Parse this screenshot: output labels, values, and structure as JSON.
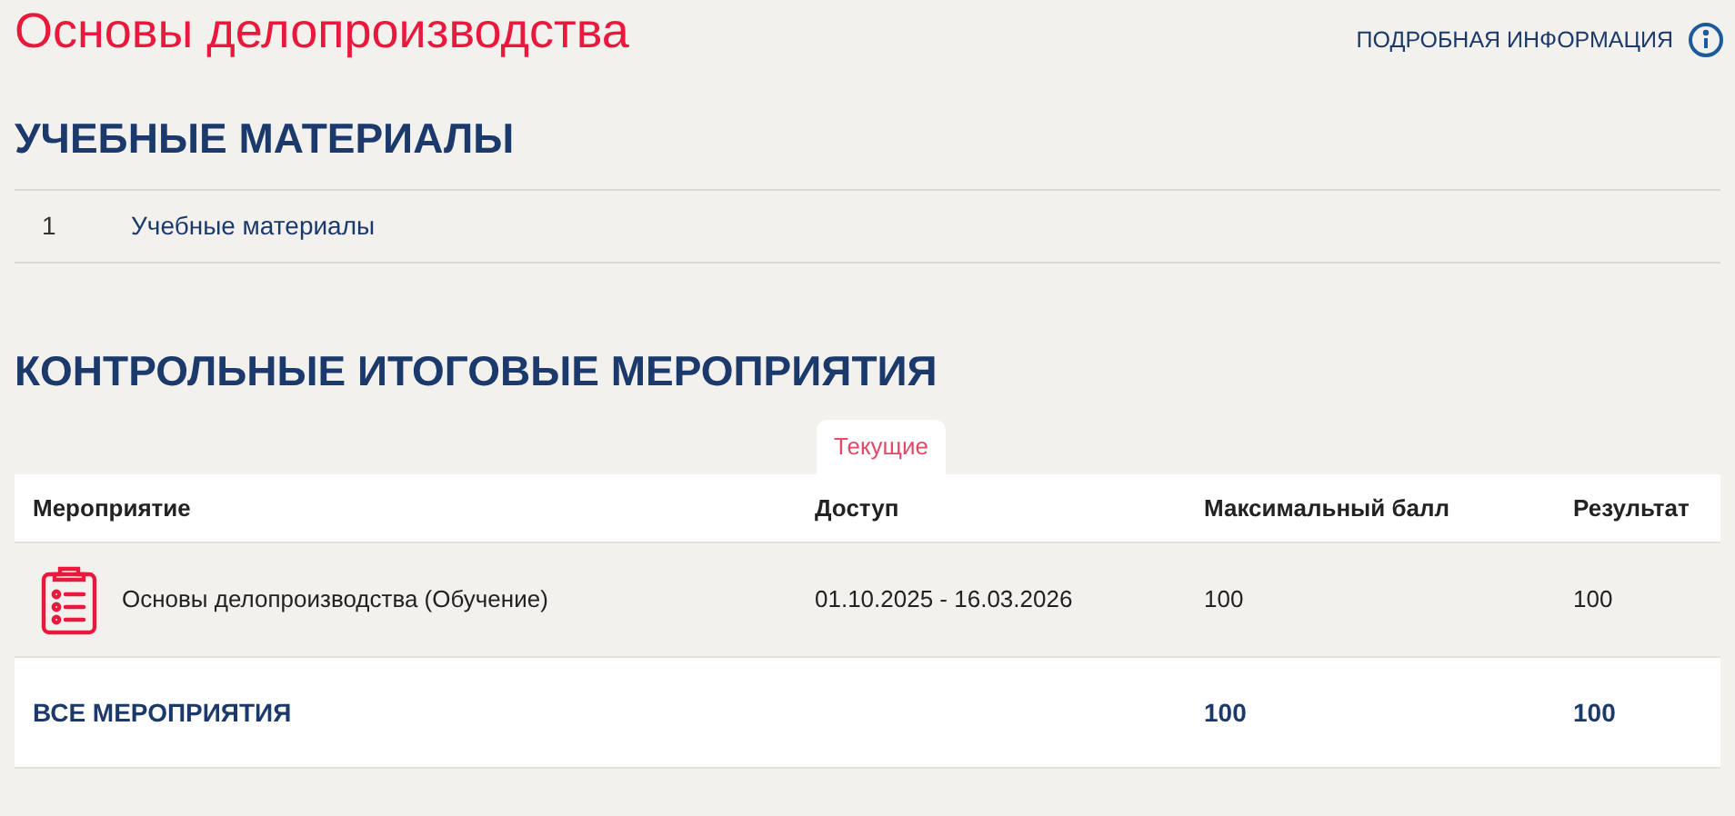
{
  "title": "Основы делопроизводства",
  "info_link": "ПОДРОБНАЯ ИНФОРМАЦИЯ",
  "materials": {
    "heading": "УЧЕБНЫЕ МАТЕРИАЛЫ",
    "items": [
      {
        "number": "1",
        "label": "Учебные материалы"
      }
    ]
  },
  "events": {
    "heading": "КОНТРОЛЬНЫЕ ИТОГОВЫЕ МЕРОПРИЯТИЯ",
    "tabs": [
      {
        "label": "Текущие",
        "selected": true
      }
    ],
    "columns": [
      "Мероприятие",
      "Доступ",
      "Максимальный балл",
      "Результат"
    ],
    "rows": [
      {
        "name": "Основы делопроизводства (Обучение)",
        "access": "01.10.2025 - 16.03.2026",
        "max": "100",
        "result": "100"
      }
    ],
    "total": {
      "label": "ВСЕ МЕРОПРИЯТИЯ",
      "max": "100",
      "result": "100"
    }
  }
}
